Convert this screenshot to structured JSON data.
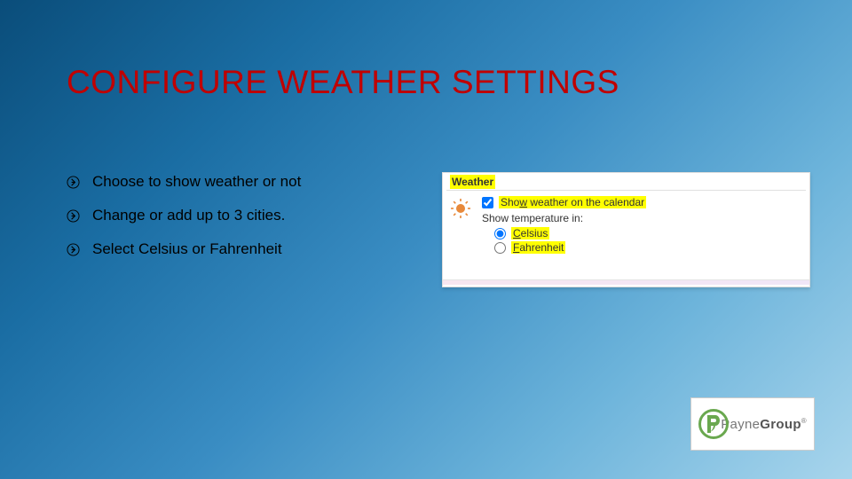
{
  "title": "CONFIGURE WEATHER SETTINGS",
  "bullets": [
    "Choose to show weather or not",
    "Change or add up to 3 cities.",
    "Select Celsius or Fahrenheit"
  ],
  "panel": {
    "header": "Weather",
    "checkbox_label": "Show weather on the calendar",
    "checkbox_accel": "w",
    "checkbox_checked": true,
    "prompt": "Show temperature in:",
    "radios": [
      {
        "label": "Celsius",
        "accel": "C",
        "selected": true
      },
      {
        "label": "Fahrenheit",
        "accel": "F",
        "selected": false
      }
    ]
  },
  "logo": {
    "brand_prefix": "Payne",
    "brand_suffix": "Group"
  }
}
